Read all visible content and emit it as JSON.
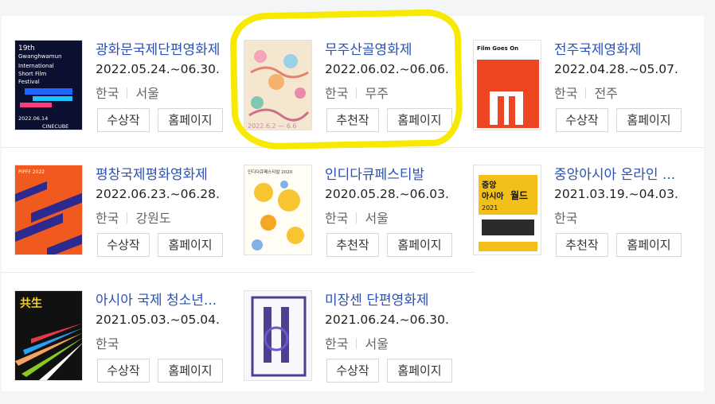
{
  "festivals": [
    {
      "title": "광화문국제단편영화제",
      "date": "2022.05.24.~06.30.",
      "country": "한국",
      "city": "서울",
      "btn1": "수상작",
      "btn2": "홈페이지",
      "poster": {
        "lines": [
          "19th",
          "Gwanghwamun",
          "International",
          "Short Film",
          "Festival",
          "2022.06.14",
          "CINECUBE"
        ]
      }
    },
    {
      "title": "무주산골영화제",
      "date": "2022.06.02.~06.06.",
      "country": "한국",
      "city": "무주",
      "btn1": "추천작",
      "btn2": "홈페이지",
      "poster": {
        "lines": [
          "2022.6.2 — 6.6"
        ]
      }
    },
    {
      "title": "전주국제영화제",
      "date": "2022.04.28.~05.07.",
      "country": "한국",
      "city": "전주",
      "btn1": "수상작",
      "btn2": "홈페이지",
      "poster": {
        "lines": [
          "Film Goes On"
        ]
      }
    },
    {
      "title": "평창국제평화영화제",
      "date": "2022.06.23.~06.28.",
      "country": "한국",
      "city": "강원도",
      "btn1": "수상작",
      "btn2": "홈페이지",
      "poster": {
        "lines": [
          "PIPFF 2022"
        ]
      }
    },
    {
      "title": "인디다큐페스티발",
      "date": "2020.05.28.~06.03.",
      "country": "한국",
      "city": "서울",
      "btn1": "추천작",
      "btn2": "홈페이지",
      "poster": {
        "lines": [
          "인디다큐페스티발 2020"
        ]
      }
    },
    {
      "title": "중앙아시아 온라인 ...",
      "date": "2021.03.19.~04.03.",
      "country": "한국",
      "city": "",
      "btn1": "추천작",
      "btn2": "홈페이지",
      "poster": {
        "lines": [
          "중앙",
          "아시아",
          "월드",
          "2021"
        ]
      }
    },
    {
      "title": "아시아 국제 청소년...",
      "date": "2021.05.03.~05.04.",
      "country": "한국",
      "city": "",
      "btn1": "수상작",
      "btn2": "홈페이지",
      "poster": {
        "lines": [
          "共生"
        ]
      }
    },
    {
      "title": "미장센 단편영화제",
      "date": "2021.06.24.~06.30.",
      "country": "한국",
      "city": "서울",
      "btn1": "수상작",
      "btn2": "홈페이지",
      "poster": {
        "lines": []
      }
    }
  ],
  "colors": {
    "title": "#2a51b5",
    "highlight": "#f7ea00",
    "jeonju_poster": "#ee4523",
    "pyeongchang_poster": "#f05a1e"
  }
}
